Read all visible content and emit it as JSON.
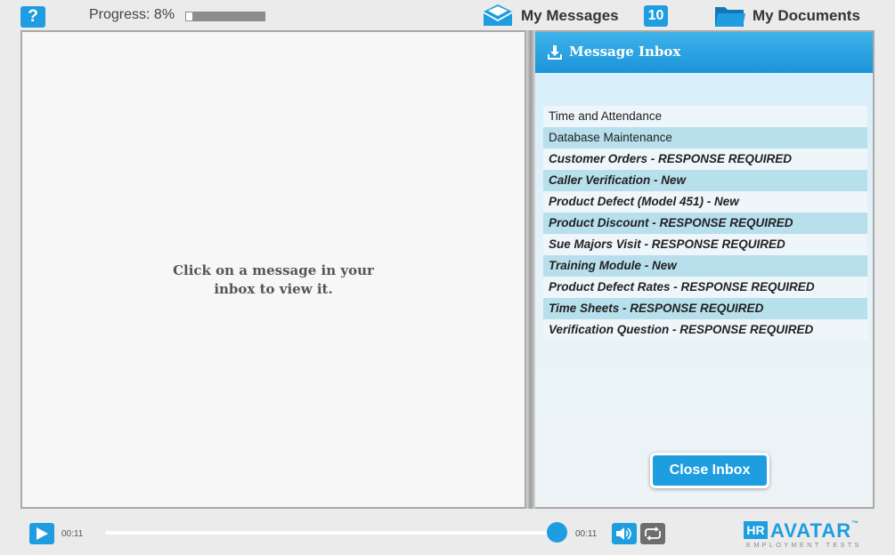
{
  "header": {
    "help_label": "?",
    "progress_label": "Progress: 8%",
    "progress_fraction": 0.08,
    "messages_label": "My Messages",
    "messages_count": "10",
    "documents_label": "My Documents"
  },
  "viewer": {
    "hint_line1": "Click on a message in your",
    "hint_line2": "inbox to view it."
  },
  "inbox": {
    "title": "Message Inbox",
    "close_label": "Close Inbox",
    "messages": [
      {
        "subject": "Time and Attendance",
        "unread": false
      },
      {
        "subject": "Database Maintenance",
        "unread": false
      },
      {
        "subject": "Customer Orders - RESPONSE REQUIRED",
        "unread": true
      },
      {
        "subject": "Caller Verification - New",
        "unread": true
      },
      {
        "subject": "Product Defect (Model 451) - New",
        "unread": true
      },
      {
        "subject": "Product Discount -  RESPONSE REQUIRED",
        "unread": true
      },
      {
        "subject": "Sue Majors Visit -  RESPONSE REQUIRED",
        "unread": true
      },
      {
        "subject": "Training Module - New",
        "unread": true
      },
      {
        "subject": "Product Defect Rates -  RESPONSE REQUIRED",
        "unread": true
      },
      {
        "subject": "Time Sheets - RESPONSE REQUIRED",
        "unread": true
      },
      {
        "subject": "Verification Question - RESPONSE REQUIRED",
        "unread": true
      }
    ]
  },
  "player": {
    "elapsed": "00:11",
    "duration": "00:11"
  },
  "brand": {
    "hr": "HR",
    "name": "AVATAR",
    "tm": "™",
    "tagline": "EMPLOYMENT TESTS"
  },
  "colors": {
    "accent": "#1e9de0",
    "row_alt": "#b7dfec"
  }
}
